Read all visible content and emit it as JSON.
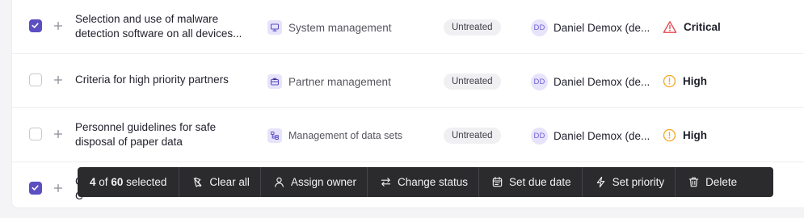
{
  "rows": [
    {
      "checked": true,
      "title_line1": "Selection and use of malware",
      "title_line2": "detection software on all devices...",
      "category": "System management",
      "category_icon": "monitor-icon",
      "status": "Untreated",
      "owner_initials": "DD",
      "owner_name": "Daniel Demox (de...",
      "priority": "Critical",
      "priority_icon": "warning-triangle-icon",
      "priority_color": "#e5484d"
    },
    {
      "checked": false,
      "title_line1": "Criteria for high priority partners",
      "category": "Partner management",
      "category_icon": "briefcase-icon",
      "status": "Untreated",
      "owner_initials": "DD",
      "owner_name": "Daniel Demox (de...",
      "priority": "High",
      "priority_icon": "alert-circle-icon",
      "priority_color": "#f5a524"
    },
    {
      "checked": false,
      "title_line1": "Personnel guidelines for safe",
      "title_line2": "disposal of paper data",
      "category": "Management of data sets",
      "category_icon": "dataset-icon",
      "status": "Untreated",
      "owner_initials": "DD",
      "owner_name": "Daniel Demox (de...",
      "priority": "High",
      "priority_icon": "alert-circle-icon",
      "priority_color": "#f5a524"
    },
    {
      "checked": true,
      "title_line1": "C",
      "title_line2": "C"
    }
  ],
  "actionbar": {
    "selected_count": "4",
    "of_text": "of",
    "total_count": "60",
    "selected_text": "selected",
    "clear_all": "Clear all",
    "assign_owner": "Assign owner",
    "change_status": "Change status",
    "set_due_date": "Set due date",
    "set_priority": "Set priority",
    "delete": "Delete"
  },
  "colors": {
    "accent": "#5b4fc2",
    "actionbar_bg": "#2b2b2e",
    "critical": "#e5484d",
    "high": "#f5a524"
  }
}
